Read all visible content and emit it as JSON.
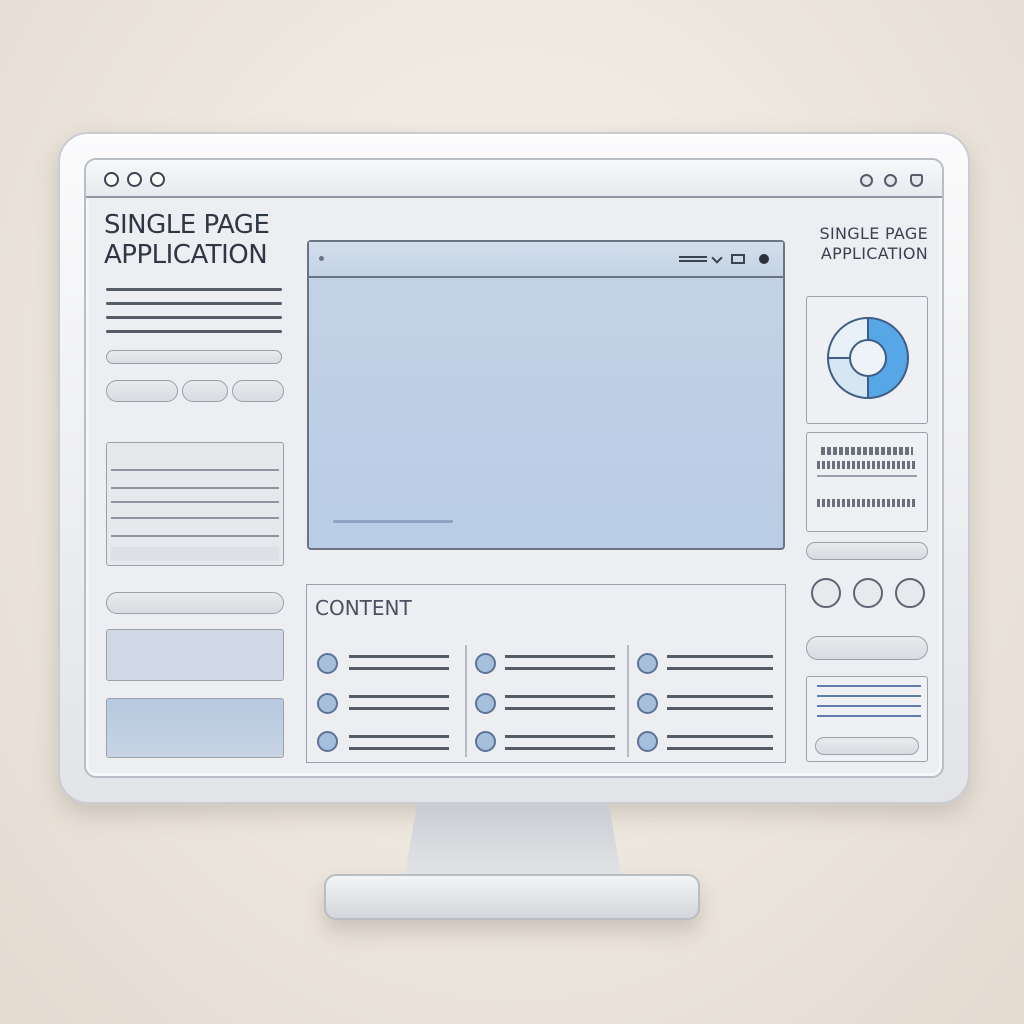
{
  "app": {
    "heading": "SINGLE PAGE\nAPPLICATION",
    "right_heading": "SINGLE PAGE\nAPPLICATION",
    "content_label": "CONTENT"
  },
  "icons": {
    "window_controls": [
      "circle-icon",
      "circle-icon",
      "circle-icon"
    ],
    "titlebar_right": [
      "globe-icon",
      "share-icon",
      "shield-icon"
    ],
    "panel_toolbar": [
      "wifi-icon",
      "dropdown-icon",
      "grid-icon",
      "record-icon"
    ]
  },
  "colors": {
    "accent_blue": "#b9cde6",
    "bullet_blue": "#a6bfdc",
    "pie_blue": "#57a6e6",
    "pie_light": "#d6e6f3"
  },
  "chart_data": {
    "type": "pie",
    "values": [
      50,
      25,
      25
    ]
  }
}
